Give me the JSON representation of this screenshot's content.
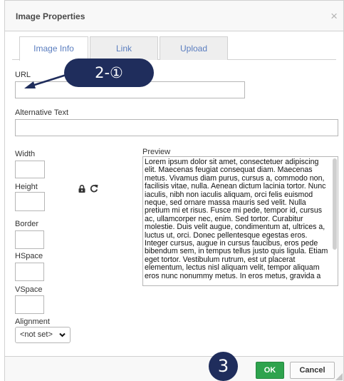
{
  "dialog": {
    "title": "Image Properties",
    "close_glyph": "×"
  },
  "tabs": [
    {
      "label": "Image Info",
      "active": true
    },
    {
      "label": "Link",
      "active": false
    },
    {
      "label": "Upload",
      "active": false
    }
  ],
  "fields": {
    "url_label": "URL",
    "url_value": "",
    "alt_label": "Alternative Text",
    "alt_value": "",
    "width_label": "Width",
    "height_label": "Height",
    "border_label": "Border",
    "hspace_label": "HSpace",
    "vspace_label": "VSpace",
    "alignment_label": "Alignment",
    "alignment_value": "<not set>"
  },
  "preview": {
    "label": "Preview",
    "text": "Lorem ipsum dolor sit amet, consectetuer adipiscing elit. Maecenas feugiat consequat diam. Maecenas metus. Vivamus diam purus, cursus a, commodo non, facilisis vitae, nulla. Aenean dictum lacinia tortor. Nunc iaculis, nibh non iaculis aliquam, orci felis euismod neque, sed ornare massa mauris sed velit. Nulla pretium mi et risus. Fusce mi pede, tempor id, cursus ac, ullamcorper nec, enim. Sed tortor. Curabitur molestie. Duis velit augue, condimentum at, ultrices a, luctus ut, orci. Donec pellentesque egestas eros. Integer cursus, augue in cursus faucibus, eros pede bibendum sem, in tempus tellus justo quis ligula. Etiam eget tortor. Vestibulum rutrum, est ut placerat elementum, lectus nisl aliquam velit, tempor aliquam eros nunc nonummy metus. In eros metus, gravida a"
  },
  "footer": {
    "ok_label": "OK",
    "cancel_label": "Cancel"
  },
  "annotations": {
    "badge_1": "2-①",
    "badge_2": "3"
  },
  "icons": {
    "lock": "lock-icon",
    "reset": "reset-size-icon",
    "close": "close-icon"
  },
  "colors": {
    "ok_button": "#2ea34d",
    "tab_text": "#5a7dbf",
    "annotation_badge": "#1f2d5c"
  }
}
